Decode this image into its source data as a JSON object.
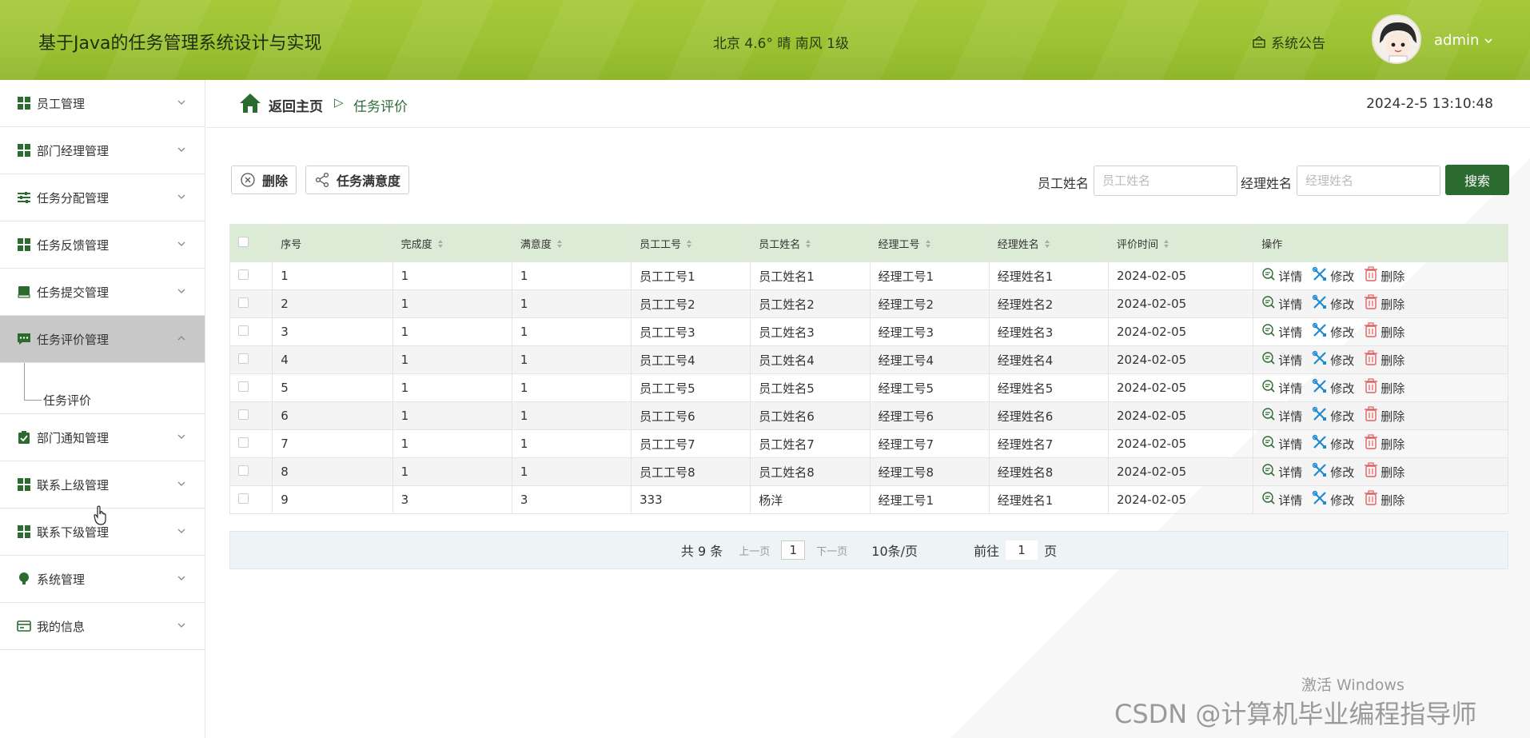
{
  "header": {
    "title": "基于Java的任务管理系统设计与实现",
    "weather": "北京  4.6°  晴  南风  1级",
    "notice": "系统公告",
    "user": "admin"
  },
  "sidebar": {
    "items": [
      {
        "label": "员工管理",
        "icon": "grid-icon"
      },
      {
        "label": "部门经理管理",
        "icon": "grid-icon"
      },
      {
        "label": "任务分配管理",
        "icon": "sliders-icon"
      },
      {
        "label": "任务反馈管理",
        "icon": "grid-icon"
      },
      {
        "label": "任务提交管理",
        "icon": "book-icon"
      },
      {
        "label": "任务评价管理",
        "icon": "chat-icon"
      },
      {
        "label": "部门通知管理",
        "icon": "clipboard-icon"
      },
      {
        "label": "联系上级管理",
        "icon": "grid-icon"
      },
      {
        "label": "联系下级管理",
        "icon": "grid-icon"
      },
      {
        "label": "系统管理",
        "icon": "bulb-icon"
      },
      {
        "label": "我的信息",
        "icon": "card-icon"
      }
    ],
    "submenu": "任务评价"
  },
  "breadcrumb": {
    "home": "返回主页",
    "separator": "▷",
    "current": "任务评价",
    "datetime": "2024-2-5 13:10:48"
  },
  "toolbar": {
    "delete_label": "删除",
    "satisfaction_label": "任务满意度",
    "employee_name_label": "员工姓名",
    "employee_name_placeholder": "员工姓名",
    "manager_name_label": "经理姓名",
    "manager_name_placeholder": "经理姓名",
    "search_label": "搜索"
  },
  "table": {
    "columns": [
      "序号",
      "完成度",
      "满意度",
      "员工工号",
      "员工姓名",
      "经理工号",
      "经理姓名",
      "评价时间",
      "操作"
    ],
    "rows": [
      [
        "1",
        "1",
        "1",
        "员工工号1",
        "员工姓名1",
        "经理工号1",
        "经理姓名1",
        "2024-02-05"
      ],
      [
        "2",
        "1",
        "1",
        "员工工号2",
        "员工姓名2",
        "经理工号2",
        "经理姓名2",
        "2024-02-05"
      ],
      [
        "3",
        "1",
        "1",
        "员工工号3",
        "员工姓名3",
        "经理工号3",
        "经理姓名3",
        "2024-02-05"
      ],
      [
        "4",
        "1",
        "1",
        "员工工号4",
        "员工姓名4",
        "经理工号4",
        "经理姓名4",
        "2024-02-05"
      ],
      [
        "5",
        "1",
        "1",
        "员工工号5",
        "员工姓名5",
        "经理工号5",
        "经理姓名5",
        "2024-02-05"
      ],
      [
        "6",
        "1",
        "1",
        "员工工号6",
        "员工姓名6",
        "经理工号6",
        "经理姓名6",
        "2024-02-05"
      ],
      [
        "7",
        "1",
        "1",
        "员工工号7",
        "员工姓名7",
        "经理工号7",
        "经理姓名7",
        "2024-02-05"
      ],
      [
        "8",
        "1",
        "1",
        "员工工号8",
        "员工姓名8",
        "经理工号8",
        "经理姓名8",
        "2024-02-05"
      ],
      [
        "9",
        "3",
        "3",
        "333",
        "杨洋",
        "经理工号1",
        "经理姓名1",
        "2024-02-05"
      ]
    ],
    "ops": {
      "detail": "详情",
      "edit": "修改",
      "delete": "删除"
    }
  },
  "pager": {
    "total": "共 9 条",
    "prev": "上一页",
    "page": "1",
    "next": "下一页",
    "size": "10条/页",
    "goto": "前往",
    "goto_value": "1",
    "page_unit": "页"
  },
  "watermark": {
    "windows": "激活 Windows",
    "csdn": "CSDN @计算机毕业编程指导师"
  },
  "colors": {
    "header_green": "#9bc132",
    "accent_dark_green": "#2c6b2f",
    "table_header_bg": "#dcebd6",
    "active_menu_bg": "#c8c8c8"
  }
}
